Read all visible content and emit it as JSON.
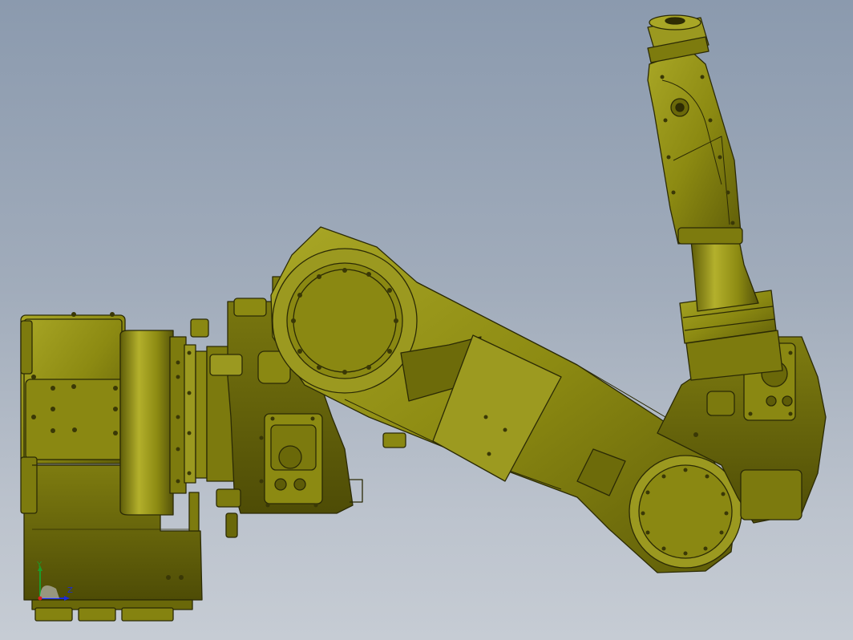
{
  "viewport": {
    "background_top": "#8b9aae",
    "background_bottom": "#c6ccd4",
    "model_color": "#8c8a12",
    "model_edge_color": "#2b2a05"
  },
  "triad": {
    "y_label": "Y",
    "z_label": "Z",
    "y_color": "#1d9b2a",
    "z_color": "#1b2ad8"
  }
}
